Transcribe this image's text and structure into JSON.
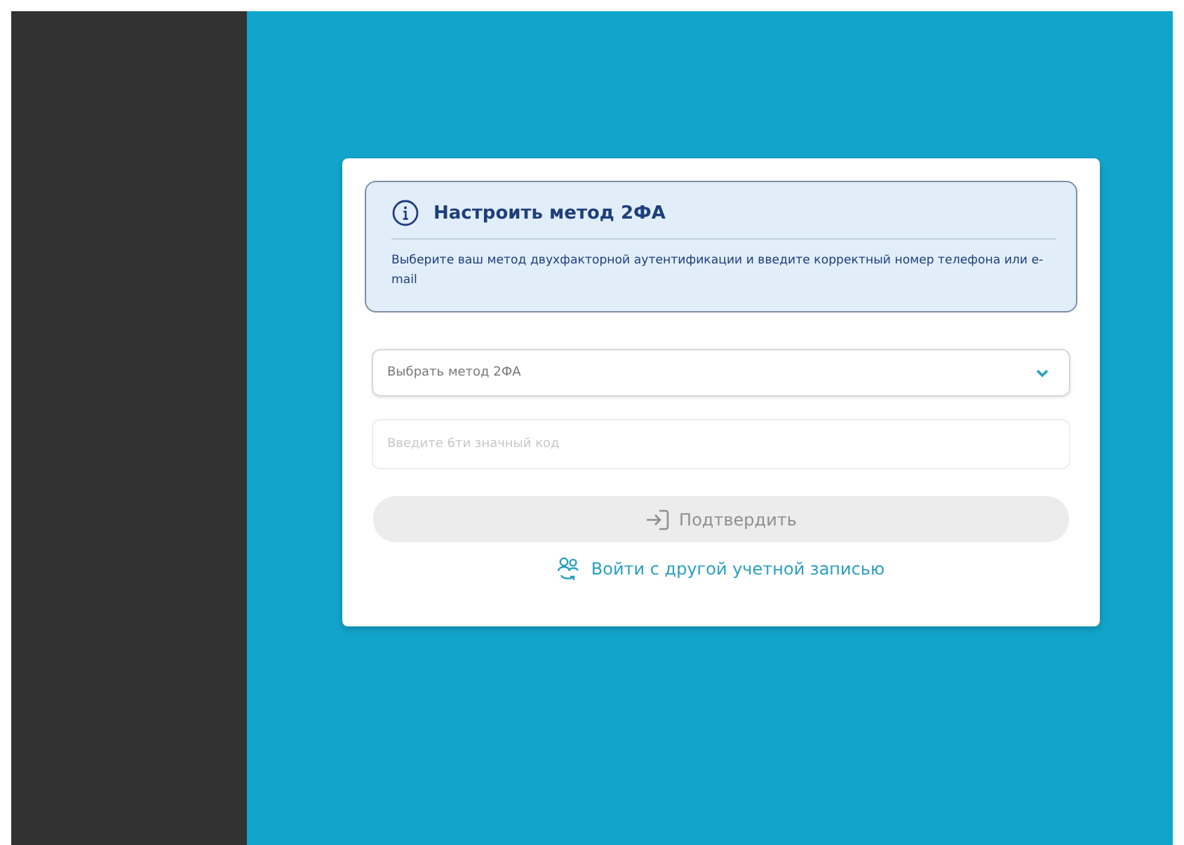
{
  "notice": {
    "title": "Настроить метод 2ФА",
    "text": "Выберите ваш метод двухфакторной аутентификации и введите корректный номер телефона или e-mail"
  },
  "method_select": {
    "placeholder": "Выбрать метод 2ФА"
  },
  "code_field": {
    "placeholder": "Введите 6ти значный код"
  },
  "confirm_button": {
    "label": "Подтвердить",
    "disabled": true
  },
  "switch_account_link": {
    "label": "Войти с другой учетной записью"
  }
}
